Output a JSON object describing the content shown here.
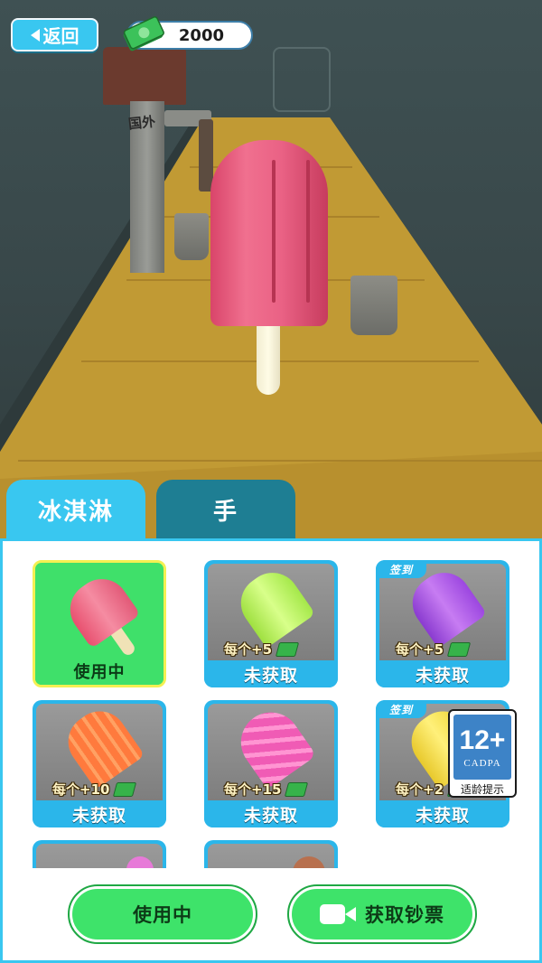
{
  "header": {
    "back_label": "返回",
    "money": "2000",
    "machine_label": "国外"
  },
  "tabs": [
    {
      "label": "冰淇淋",
      "active": true
    },
    {
      "label": "手",
      "active": false
    }
  ],
  "items": [
    {
      "status": "使用中",
      "reward": "",
      "badge": "",
      "color": "#f06a86",
      "state": "in_use"
    },
    {
      "status": "未获取",
      "reward": "每个+5",
      "badge": "",
      "color": "#b9f25a",
      "state": "locked"
    },
    {
      "status": "未获取",
      "reward": "每个+5",
      "badge": "签到",
      "color": "#a64ee6",
      "state": "locked"
    },
    {
      "status": "未获取",
      "reward": "每个+10",
      "badge": "",
      "color": "#ff7a3d",
      "state": "locked"
    },
    {
      "status": "未获取",
      "reward": "每个+15",
      "badge": "",
      "color": "#f05bb5",
      "state": "locked"
    },
    {
      "status": "未获取",
      "reward": "每个+2",
      "badge": "签到",
      "color": "#f2e24a",
      "state": "locked"
    },
    {
      "status": "",
      "reward": "",
      "badge": "",
      "color": "#e77ad8",
      "state": "partial"
    },
    {
      "status": "",
      "reward": "",
      "badge": "",
      "color": "#b8704e",
      "state": "partial"
    }
  ],
  "buttons": {
    "use_label": "使用中",
    "get_label": "获取钞票"
  },
  "age_rating": {
    "rating": "12+",
    "org": "CADPA",
    "text": "适龄提示"
  },
  "colors": {
    "accent": "#39c7f0",
    "green": "#3ee36a",
    "popsicle": "#ea6285"
  }
}
